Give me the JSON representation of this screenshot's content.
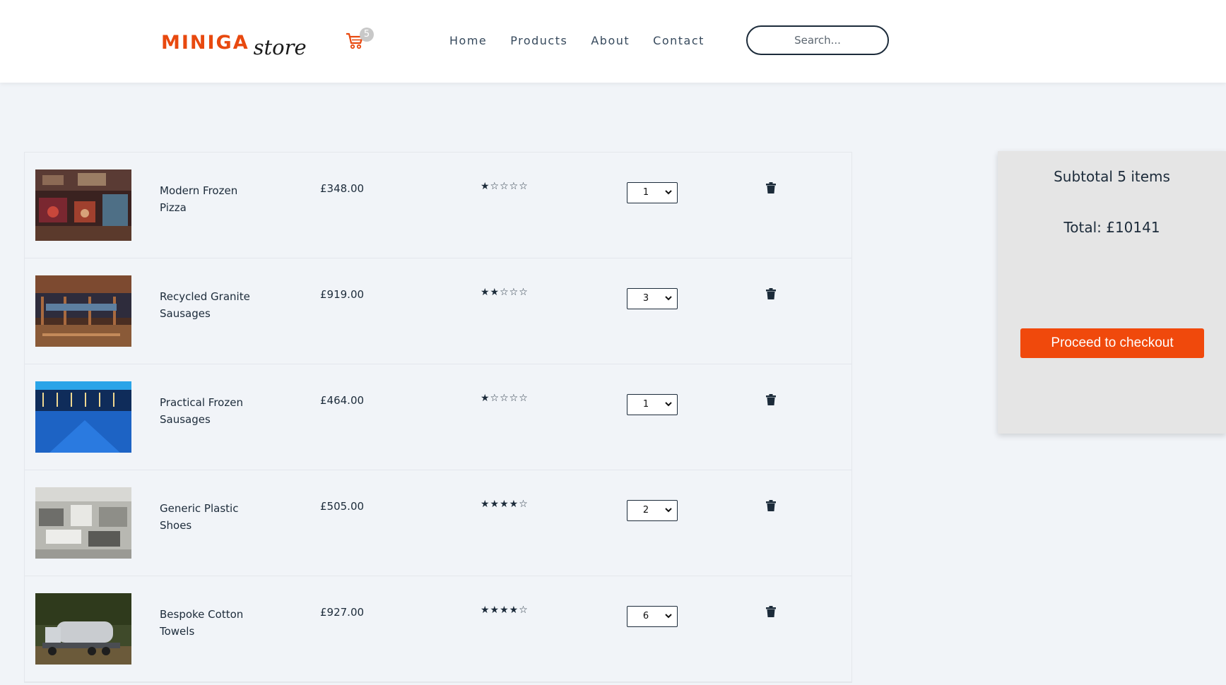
{
  "brand": {
    "name": "MINIGA",
    "tagline": "store",
    "accent_color": "#e8490f"
  },
  "header": {
    "cart_icon": "shopping-cart-icon",
    "cart_count": "5",
    "nav": [
      "Home",
      "Products",
      "About",
      "Contact"
    ],
    "search": {
      "placeholder": "Search...",
      "value": ""
    }
  },
  "cart": {
    "items": [
      {
        "name": "Modern Frozen Pizza",
        "price": "£348.00",
        "stars": "★☆☆☆☆",
        "rating": 1,
        "quantity": "1",
        "delete_icon": "trash-icon"
      },
      {
        "name": "Recycled Granite Sausages",
        "price": "£919.00",
        "stars": "★★☆☆☆",
        "rating": 2,
        "quantity": "3",
        "delete_icon": "trash-icon"
      },
      {
        "name": "Practical Frozen Sausages",
        "price": "£464.00",
        "stars": "★☆☆☆☆",
        "rating": 1,
        "quantity": "1",
        "delete_icon": "trash-icon"
      },
      {
        "name": "Generic Plastic Shoes",
        "price": "£505.00",
        "stars": "★★★★☆",
        "rating": 4,
        "quantity": "2",
        "delete_icon": "trash-icon"
      },
      {
        "name": "Bespoke Cotton Towels",
        "price": "£927.00",
        "stars": "★★★★☆",
        "rating": 4,
        "quantity": "6",
        "delete_icon": "trash-icon"
      }
    ]
  },
  "summary": {
    "subtotal_label": "Subtotal 5 items",
    "total_label": "Total: £10141",
    "checkout_label": "Proceed to checkout",
    "checkout_color": "#f0490c"
  }
}
